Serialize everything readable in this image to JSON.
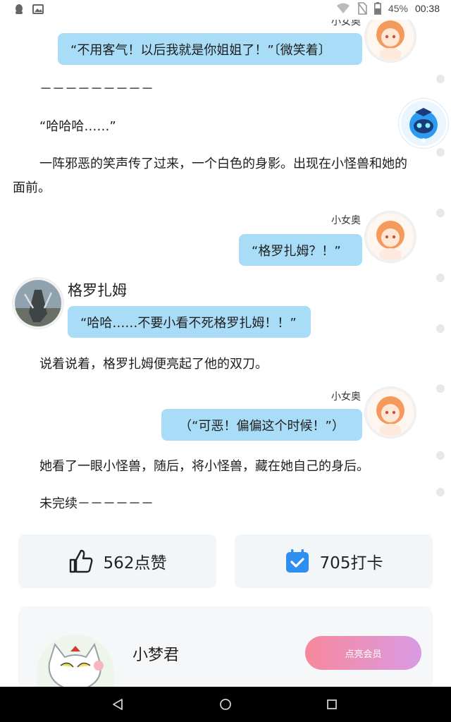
{
  "status_bar": {
    "battery": "45%",
    "time": "00:38",
    "icons": [
      "qq-icon",
      "image-icon",
      "wifi-icon",
      "no-sim-icon",
      "battery-icon"
    ]
  },
  "messages": [
    {
      "type": "bubble",
      "side": "right",
      "speaker": "小女奥",
      "text": "“不用客气！以后我就是你姐姐了！”〔微笑着〕"
    },
    {
      "type": "narration",
      "text": "－－－－－－－－－"
    },
    {
      "type": "narration",
      "text": "“哈哈哈……”"
    },
    {
      "type": "narration",
      "text": "一阵邪恶的笑声传了过来，一个白色的身影。出现在小怪兽和她的"
    },
    {
      "type": "narration",
      "text": "面前。"
    },
    {
      "type": "bubble",
      "side": "right",
      "speaker": "小女奥",
      "text": "“格罗扎姆？！”"
    },
    {
      "type": "bubble",
      "side": "left",
      "speaker": "格罗扎姆",
      "text": "“哈哈……不要小看不死格罗扎姆！！”"
    },
    {
      "type": "narration",
      "text": "说着说着，格罗扎姆便亮起了他的双刀。"
    },
    {
      "type": "bubble",
      "side": "right",
      "speaker": "小女奥",
      "text": "（“可恶！偏偏这个时候！”）"
    },
    {
      "type": "narration",
      "text": "她看了一眼小怪兽，随后，将小怪兽，藏在她自己的身后。"
    },
    {
      "type": "narration",
      "text": "未完续－－－－－－"
    }
  ],
  "actions": {
    "like_label": "562点赞",
    "checkin_label": "705打卡"
  },
  "member": {
    "name": "小梦君",
    "button_label": "点亮会员"
  },
  "colors": {
    "bubble": "#a9ddf7",
    "card_bg": "#f3f6f9",
    "checkin_blue": "#2f8ff0",
    "member_gradient_start": "#f7889b",
    "member_gradient_end": "#d99be4"
  },
  "navbar": {
    "icons": [
      "back-icon",
      "home-icon",
      "recents-icon"
    ]
  }
}
